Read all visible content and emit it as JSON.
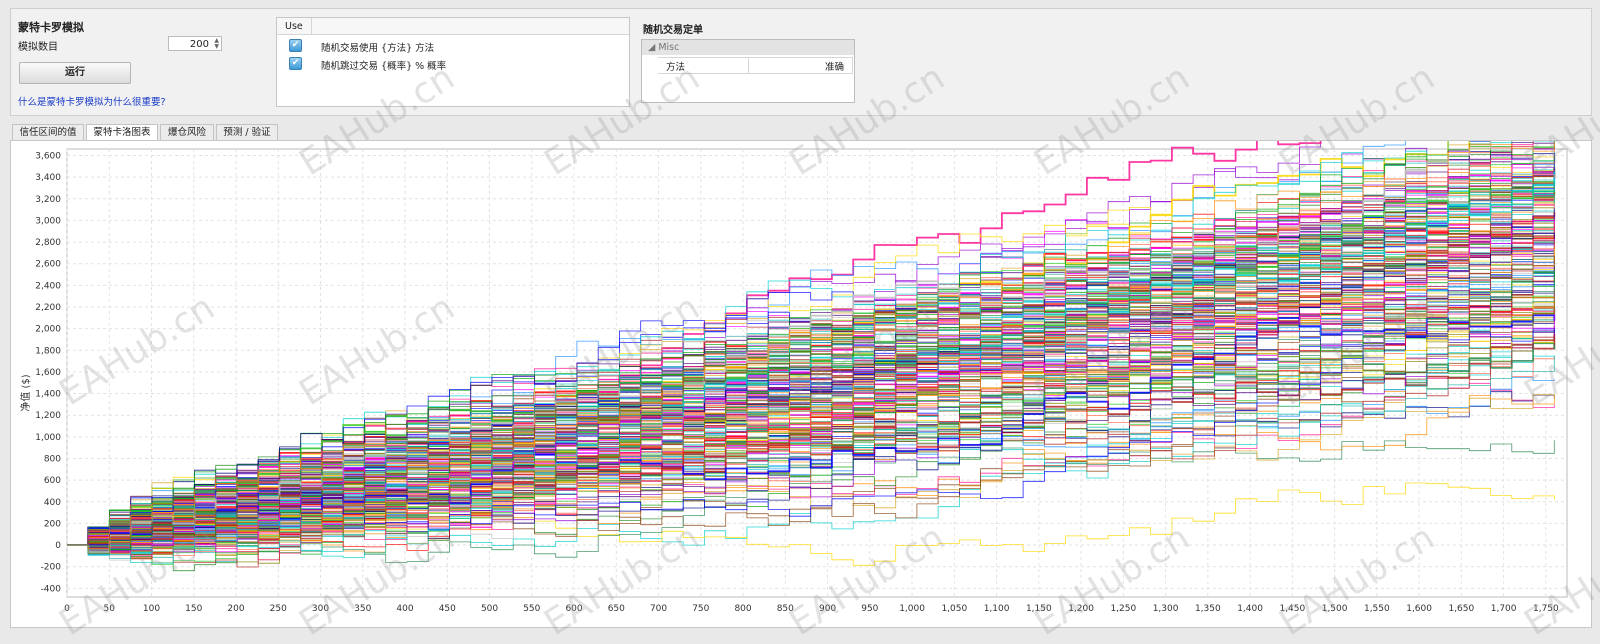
{
  "simulation": {
    "title": "蒙特卡罗模拟",
    "count_label": "模拟数目",
    "count_value": "200",
    "run_label": "运行",
    "help_link": "什么是蒙特卡罗模拟为什么很重要?"
  },
  "options": {
    "header": "Use",
    "rows": [
      {
        "label": "随机交易使用 {方法} 方法",
        "checked": true
      },
      {
        "label": "随机跳过交易 {概率} % 概率",
        "checked": true
      }
    ]
  },
  "property_grid": {
    "title": "随机交易定单",
    "category": "Misc",
    "rows": [
      {
        "key": "方法",
        "value": "准确"
      }
    ]
  },
  "tabs": [
    {
      "label": "信任区间的值",
      "active": false
    },
    {
      "label": "蒙特卡洛图表",
      "active": true
    },
    {
      "label": "爆仓风险",
      "active": false
    },
    {
      "label": "预测 / 验证",
      "active": false
    }
  ],
  "watermark_text": "EAHub.cn",
  "chart_data": {
    "type": "line",
    "ylabel": "净值 ($)",
    "xlim": [
      0,
      1775
    ],
    "ylim": [
      -480,
      3660
    ],
    "x_ticks": [
      "0",
      "50",
      "100",
      "150",
      "200",
      "250",
      "300",
      "350",
      "400",
      "450",
      "500",
      "550",
      "600",
      "650",
      "700",
      "750",
      "800",
      "850",
      "900",
      "950",
      "1,000",
      "1,050",
      "1,100",
      "1,150",
      "1,200",
      "1,250",
      "1,300",
      "1,350",
      "1,400",
      "1,450",
      "1,500",
      "1,550",
      "1,600",
      "1,650",
      "1,700",
      "1,750"
    ],
    "y_ticks": [
      "-400",
      "-200",
      "0",
      "200",
      "400",
      "600",
      "800",
      "1,000",
      "1,200",
      "1,400",
      "1,600",
      "1,800",
      "2,000",
      "2,200",
      "2,400",
      "2,600",
      "2,800",
      "3,000",
      "3,200",
      "3,400",
      "3,600"
    ],
    "series_count": 200,
    "n_trades": 1760,
    "start_value": 0,
    "end_range": [
      2300,
      3400
    ],
    "series_colors": [
      "#ff0000",
      "#00a000",
      "#0000ff",
      "#ff00ff",
      "#00cccc",
      "#ff8c00",
      "#8b4513",
      "#808000",
      "#9400d3",
      "#00ced1",
      "#ff1493",
      "#228b22",
      "#1e90ff",
      "#b22222",
      "#daa520",
      "#4b0082",
      "#32cd32",
      "#dc143c",
      "#20b2aa",
      "#c0c0c0",
      "#ffd700",
      "#000080",
      "#ff6347",
      "#2e8b57"
    ],
    "grid": true
  }
}
